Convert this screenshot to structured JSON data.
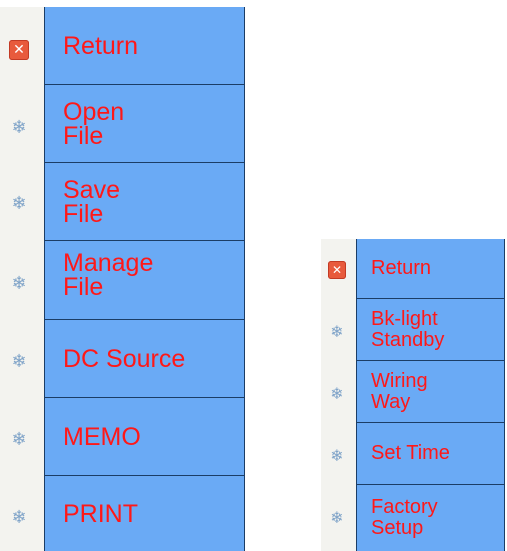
{
  "colors": {
    "panel": "#6aaaf5",
    "text": "#ff1818",
    "divider": "#1b3d66",
    "strip": "#f3f3ef"
  },
  "file_menu": {
    "items": [
      {
        "label": "Return",
        "icon": "close-icon"
      },
      {
        "label": "Open\nFile",
        "icon": "snowflake-icon"
      },
      {
        "label": "Save\nFile",
        "icon": "snowflake-icon"
      },
      {
        "label": "Manage\nFile",
        "icon": "snowflake-icon"
      },
      {
        "label": "DC Source",
        "icon": "snowflake-icon"
      },
      {
        "label": "MEMO",
        "icon": "snowflake-icon"
      },
      {
        "label": "PRINT",
        "icon": "snowflake-icon"
      }
    ]
  },
  "settings_menu": {
    "items": [
      {
        "label": "Return",
        "icon": "close-icon"
      },
      {
        "label": "Bk-light\nStandby",
        "icon": "snowflake-icon"
      },
      {
        "label": "Wiring\nWay",
        "icon": "snowflake-icon"
      },
      {
        "label": "Set Time",
        "icon": "snowflake-icon"
      },
      {
        "label": "Factory\nSetup",
        "icon": "snowflake-icon"
      }
    ]
  }
}
